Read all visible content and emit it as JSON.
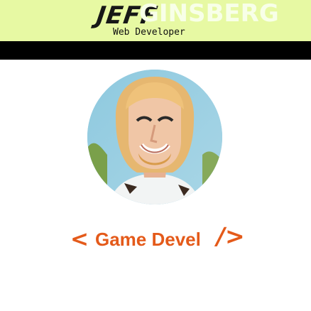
{
  "header": {
    "first_name": "JEFF",
    "last_name": "GINSBERG",
    "tagline": "Web Developer"
  },
  "avatar": {
    "alt": "profile photo"
  },
  "headline": {
    "open_bracket": "<",
    "text": "Game Devel",
    "close_bracket": "/>"
  },
  "colors": {
    "header_bg": "#e7f9a3",
    "accent": "#e45a1a",
    "bar": "#000000"
  }
}
